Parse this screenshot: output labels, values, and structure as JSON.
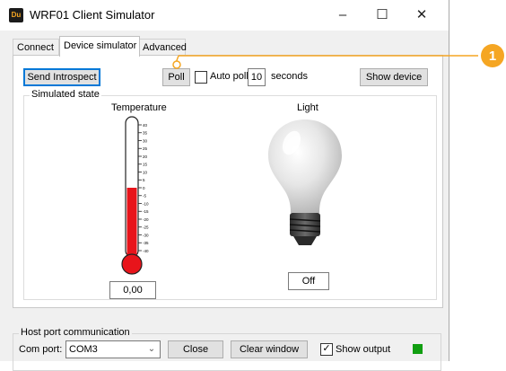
{
  "window": {
    "title": "WRF01 Client Simulator",
    "app_icon_text": "Du",
    "minimize_glyph": "–",
    "maximize_glyph": "☐",
    "close_glyph": "✕"
  },
  "tabs": [
    {
      "label": "Connect"
    },
    {
      "label": "Device simulator"
    },
    {
      "label": "Advanced"
    }
  ],
  "toolbar": {
    "send_introspect_label": "Send Introspect",
    "poll_label": "Poll",
    "auto_poll_label": "Auto poll",
    "auto_poll_checked": false,
    "poll_interval_value": "10",
    "seconds_label": "seconds",
    "show_device_label": "Show device"
  },
  "simulated_state": {
    "group_label": "Simulated state",
    "temperature": {
      "label": "Temperature",
      "value": "0,00",
      "scale_labels": [
        "40",
        "35",
        "30",
        "25",
        "20",
        "15",
        "10",
        "5",
        "0",
        "-5",
        "-10",
        "-15",
        "-20",
        "-25",
        "-30",
        "-35",
        "-40"
      ],
      "fill_fraction": 0.5,
      "fill_color": "#e8141b"
    },
    "light": {
      "label": "Light",
      "state": "Off"
    }
  },
  "host_port": {
    "group_label": "Host port communication",
    "com_port_label": "Com port:",
    "com_port_value": "COM3",
    "close_label": "Close",
    "clear_window_label": "Clear window",
    "show_output_label": "Show output",
    "show_output_checked": true,
    "status_color": "#119e11"
  },
  "callout": {
    "number": "1",
    "color": "#f5a623"
  }
}
